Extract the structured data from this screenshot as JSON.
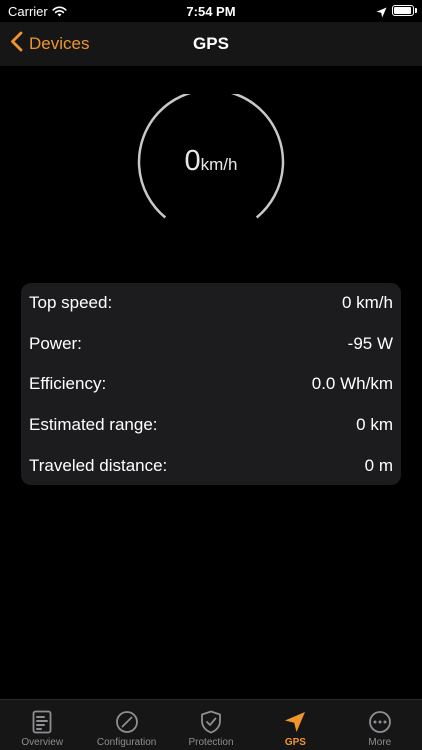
{
  "status_bar": {
    "carrier": "Carrier",
    "time": "7:54 PM",
    "battery_level": 0.95
  },
  "nav": {
    "back_label": "Devices",
    "title": "GPS"
  },
  "gauge": {
    "value": "0",
    "unit": "km/h"
  },
  "stats": [
    {
      "label": "Top speed:",
      "value": "0 km/h"
    },
    {
      "label": "Power:",
      "value": "-95 W"
    },
    {
      "label": "Efficiency:",
      "value": "0.0 Wh/km"
    },
    {
      "label": "Estimated range:",
      "value": "0 km"
    },
    {
      "label": "Traveled distance:",
      "value": "0 m"
    }
  ],
  "tabs": [
    {
      "label": "Overview",
      "icon": "document-icon",
      "active": false
    },
    {
      "label": "Configuration",
      "icon": "slash-circle-icon",
      "active": false
    },
    {
      "label": "Protection",
      "icon": "shield-check-icon",
      "active": false
    },
    {
      "label": "GPS",
      "icon": "location-arrow-icon",
      "active": true
    },
    {
      "label": "More",
      "icon": "ellipsis-circle-icon",
      "active": false
    }
  ],
  "colors": {
    "accent": "#f0952e",
    "background": "#000000",
    "card": "#1c1c1e",
    "bar": "#161616",
    "inactive": "#8e8e93"
  }
}
